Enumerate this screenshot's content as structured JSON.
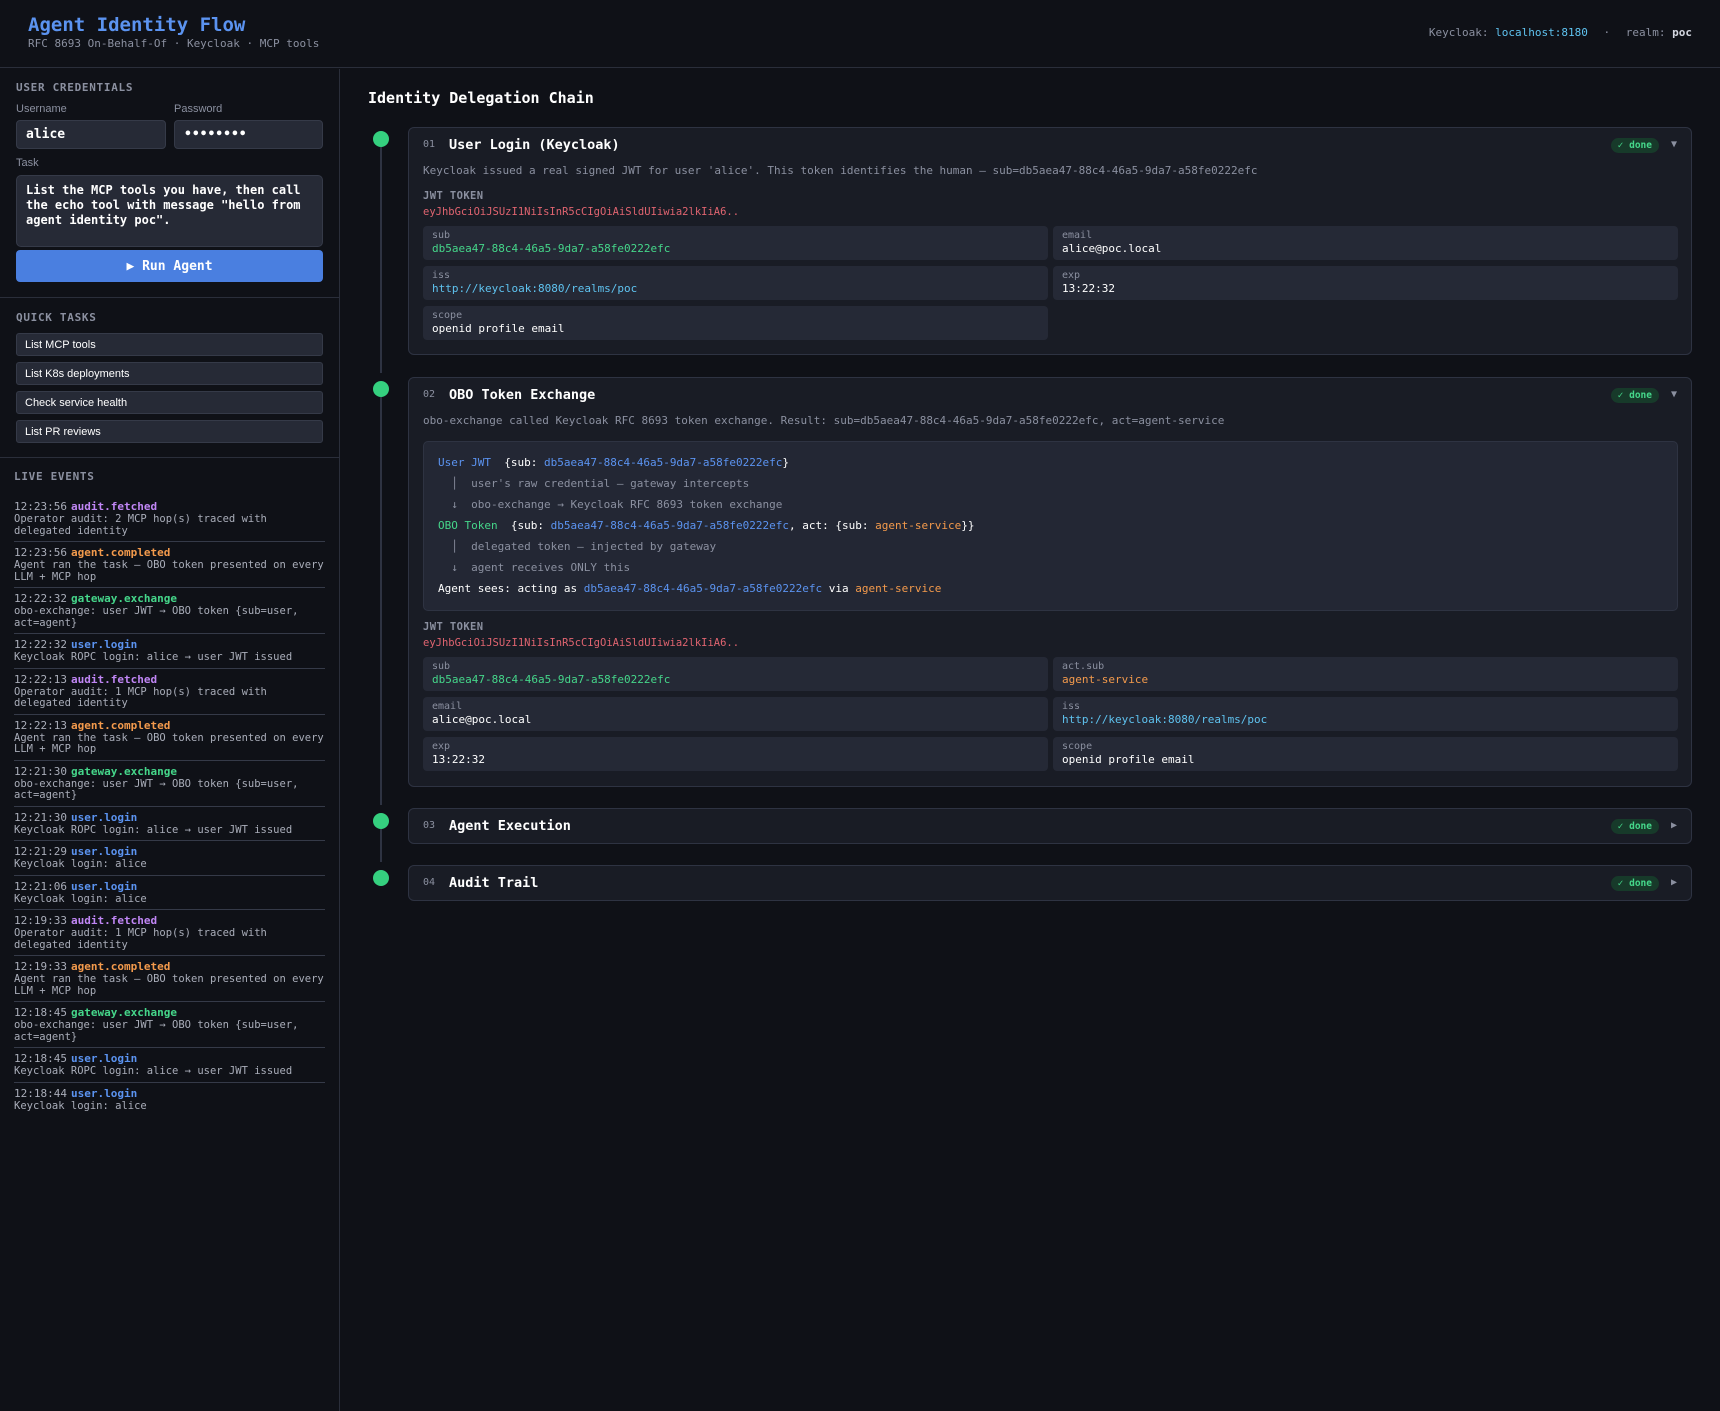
{
  "header": {
    "title": "Agent Identity Flow",
    "subtitle": "RFC 8693 On-Behalf-Of · Keycloak · MCP tools",
    "keycloak_label": "Keycloak:",
    "keycloak_host": "localhost:8180",
    "separator": "·",
    "realm_label": "realm:",
    "realm_value": "poc"
  },
  "credentials": {
    "section_label": "USER CREDENTIALS",
    "username_label": "Username",
    "username_value": "alice",
    "password_label": "Password",
    "password_value": "••••••••",
    "task_label": "Task",
    "task_value": "List the MCP tools you have, then call the echo tool with message \"hello from agent identity poc\".",
    "run_button": "▶ Run Agent"
  },
  "quick_tasks": {
    "section_label": "QUICK TASKS",
    "items": [
      "List MCP tools",
      "List K8s deployments",
      "Check service health",
      "List PR reviews"
    ]
  },
  "live_events": {
    "section_label": "LIVE EVENTS",
    "items": [
      {
        "time": "12:23:56",
        "type": "audit.fetched",
        "color": "purple",
        "desc": "Operator audit: 2 MCP hop(s) traced with delegated identity"
      },
      {
        "time": "12:23:56",
        "type": "agent.completed",
        "color": "orange",
        "desc": "Agent ran the task — OBO token presented on every LLM + MCP hop"
      },
      {
        "time": "12:22:32",
        "type": "gateway.exchange",
        "color": "green",
        "desc": "obo-exchange: user JWT → OBO token {sub=user, act=agent}"
      },
      {
        "time": "12:22:32",
        "type": "user.login",
        "color": "blue",
        "desc": "Keycloak ROPC login: alice → user JWT issued"
      },
      {
        "time": "12:22:13",
        "type": "audit.fetched",
        "color": "purple",
        "desc": "Operator audit: 1 MCP hop(s) traced with delegated identity"
      },
      {
        "time": "12:22:13",
        "type": "agent.completed",
        "color": "orange",
        "desc": "Agent ran the task — OBO token presented on every LLM + MCP hop"
      },
      {
        "time": "12:21:30",
        "type": "gateway.exchange",
        "color": "green",
        "desc": "obo-exchange: user JWT → OBO token {sub=user, act=agent}"
      },
      {
        "time": "12:21:30",
        "type": "user.login",
        "color": "blue",
        "desc": "Keycloak ROPC login: alice → user JWT issued"
      },
      {
        "time": "12:21:29",
        "type": "user.login",
        "color": "blue",
        "desc": "Keycloak login: alice"
      },
      {
        "time": "12:21:06",
        "type": "user.login",
        "color": "blue",
        "desc": "Keycloak login: alice"
      },
      {
        "time": "12:19:33",
        "type": "audit.fetched",
        "color": "purple",
        "desc": "Operator audit: 1 MCP hop(s) traced with delegated identity"
      },
      {
        "time": "12:19:33",
        "type": "agent.completed",
        "color": "orange",
        "desc": "Agent ran the task — OBO token presented on every LLM + MCP hop"
      },
      {
        "time": "12:18:45",
        "type": "gateway.exchange",
        "color": "green",
        "desc": "obo-exchange: user JWT → OBO token {sub=user, act=agent}"
      },
      {
        "time": "12:18:45",
        "type": "user.login",
        "color": "blue",
        "desc": "Keycloak ROPC login: alice → user JWT issued"
      },
      {
        "time": "12:18:44",
        "type": "user.login",
        "color": "blue",
        "desc": "Keycloak login: alice"
      }
    ]
  },
  "main": {
    "title": "Identity Delegation Chain",
    "status_badge": "✓ done",
    "chevron_open": "▼",
    "chevron_closed": "▶",
    "steps": [
      {
        "num": "01",
        "title": "User Login (Keycloak)",
        "desc": "Keycloak issued a real signed JWT for user 'alice'. This token identifies the human — sub=db5aea47-88c4-46a5-9da7-a58fe0222efc",
        "jwt_label": "JWT TOKEN",
        "jwt_value": "eyJhbGciOiJSUzI1NiIsInR5cCIgOiAiSldUIiwia2lkIiA6..",
        "claims": {
          "sub": {
            "key": "sub",
            "value": "db5aea47-88c4-46a5-9da7-a58fe0222efc"
          },
          "email": {
            "key": "email",
            "value": "alice@poc.local"
          },
          "iss": {
            "key": "iss",
            "value": "http://keycloak:8080/realms/poc"
          },
          "exp": {
            "key": "exp",
            "value": "13:22:32"
          },
          "scope": {
            "key": "scope",
            "value": "openid profile email"
          }
        }
      },
      {
        "num": "02",
        "title": "OBO Token Exchange",
        "desc": "obo-exchange called Keycloak RFC 8693 token exchange. Result: sub=db5aea47-88c4-46a5-9da7-a58fe0222efc, act=agent-service",
        "chain": {
          "user_jwt_label": "User JWT",
          "sub_open": "{sub: ",
          "sub_value": "db5aea47-88c4-46a5-9da7-a58fe0222efc",
          "close_brace": "}",
          "pipe": "│",
          "arrow": "↓",
          "line1": "user's raw credential — gateway intercepts",
          "line2": "obo-exchange → Keycloak RFC 8693 token exchange",
          "obo_label": "OBO Token",
          "act_open": ", act: {sub: ",
          "act_value": "agent-service",
          "close_double": "}}",
          "line3": "delegated token — injected by gateway",
          "line4": "agent receives ONLY this",
          "sees_prefix": "Agent sees: acting as ",
          "via": " via "
        },
        "jwt_label": "JWT TOKEN",
        "jwt_value": "eyJhbGciOiJSUzI1NiIsInR5cCIgOiAiSldUIiwia2lkIiA6..",
        "claims": {
          "sub": {
            "key": "sub",
            "value": "db5aea47-88c4-46a5-9da7-a58fe0222efc"
          },
          "act_sub": {
            "key": "act.sub",
            "value": "agent-service"
          },
          "email": {
            "key": "email",
            "value": "alice@poc.local"
          },
          "iss": {
            "key": "iss",
            "value": "http://keycloak:8080/realms/poc"
          },
          "exp": {
            "key": "exp",
            "value": "13:22:32"
          },
          "scope": {
            "key": "scope",
            "value": "openid profile email"
          }
        }
      },
      {
        "num": "03",
        "title": "Agent Execution"
      },
      {
        "num": "04",
        "title": "Audit Trail"
      }
    ]
  },
  "colors": {
    "background": "#0f1117",
    "accent_blue": "#5b93f0",
    "done_green": "#35d07f",
    "orange": "#f39a4c",
    "purple": "#c086f5",
    "jwt_red": "#e06470"
  }
}
